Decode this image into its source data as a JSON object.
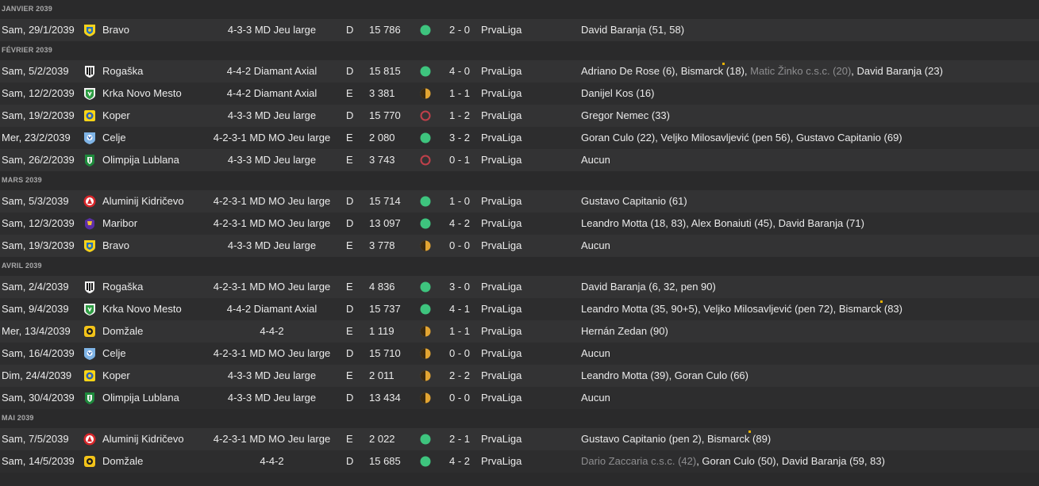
{
  "colors": {
    "win": "#3ec47e",
    "draw": "#e3a532",
    "loss": "#c0404a",
    "starMarker": "#e8b100"
  },
  "months": [
    {
      "label": "JANVIER 2039",
      "matches": [
        {
          "date": "Sam, 29/1/2039",
          "team": "Bravo",
          "badge": "bravo-badge-icon",
          "formation": "4-3-3 MD Jeu large",
          "venue": "D",
          "attendance": "15 786",
          "result": "win",
          "score": "2 - 0",
          "competition": "PrvaLiga",
          "scorers": [
            {
              "text": "David Baranja (51, 58)"
            }
          ]
        }
      ]
    },
    {
      "label": "FÉVRIER 2039",
      "matches": [
        {
          "date": "Sam, 5/2/2039",
          "team": "Rogaška",
          "badge": "rogaska-badge-icon",
          "formation": "4-4-2 Diamant Axial",
          "venue": "D",
          "attendance": "15 815",
          "result": "win",
          "score": "4 - 0",
          "competition": "PrvaLiga",
          "scorers": [
            {
              "text": "Adriano De Rose (6), "
            },
            {
              "text": "Bismarck",
              "star": true
            },
            {
              "text": " (18), "
            },
            {
              "text": "Matic Žinko c.s.c. (20)",
              "muted": true
            },
            {
              "text": ", David Baranja (23)"
            }
          ]
        },
        {
          "date": "Sam, 12/2/2039",
          "team": "Krka Novo Mesto",
          "badge": "krka-badge-icon",
          "formation": "4-4-2 Diamant Axial",
          "venue": "E",
          "attendance": "3 381",
          "result": "draw",
          "score": "1 - 1",
          "competition": "PrvaLiga",
          "scorers": [
            {
              "text": "Danijel Kos (16)"
            }
          ]
        },
        {
          "date": "Sam, 19/2/2039",
          "team": "Koper",
          "badge": "koper-badge-icon",
          "formation": "4-3-3 MD Jeu large",
          "venue": "D",
          "attendance": "15 770",
          "result": "loss",
          "score": "1 - 2",
          "competition": "PrvaLiga",
          "scorers": [
            {
              "text": "Gregor Nemec (33)"
            }
          ]
        },
        {
          "date": "Mer, 23/2/2039",
          "team": "Celje",
          "badge": "celje-badge-icon",
          "formation": "4-2-3-1 MD MO Jeu large",
          "venue": "E",
          "attendance": "2 080",
          "result": "win",
          "score": "3 - 2",
          "competition": "PrvaLiga",
          "scorers": [
            {
              "text": "Goran Culo (22), Veljko Milosavljević (pen 56), Gustavo Capitanio (69)"
            }
          ]
        },
        {
          "date": "Sam, 26/2/2039",
          "team": "Olimpija Lublana",
          "badge": "olimpija-badge-icon",
          "formation": "4-3-3 MD Jeu large",
          "venue": "E",
          "attendance": "3 743",
          "result": "loss",
          "score": "0 - 1",
          "competition": "PrvaLiga",
          "scorers": [
            {
              "text": "Aucun"
            }
          ]
        }
      ]
    },
    {
      "label": "MARS 2039",
      "matches": [
        {
          "date": "Sam, 5/3/2039",
          "team": "Aluminij Kidričevo",
          "badge": "aluminij-badge-icon",
          "formation": "4-2-3-1 MD MO Jeu large",
          "venue": "D",
          "attendance": "15 714",
          "result": "win",
          "score": "1 - 0",
          "competition": "PrvaLiga",
          "scorers": [
            {
              "text": "Gustavo Capitanio (61)"
            }
          ]
        },
        {
          "date": "Sam, 12/3/2039",
          "team": "Maribor",
          "badge": "maribor-badge-icon",
          "formation": "4-2-3-1 MD MO Jeu large",
          "venue": "D",
          "attendance": "13 097",
          "result": "win",
          "score": "4 - 2",
          "competition": "PrvaLiga",
          "scorers": [
            {
              "text": "Leandro Motta (18, 83), Alex Bonaiuti (45), David Baranja (71)"
            }
          ]
        },
        {
          "date": "Sam, 19/3/2039",
          "team": "Bravo",
          "badge": "bravo-badge-icon",
          "formation": "4-3-3 MD Jeu large",
          "venue": "E",
          "attendance": "3 778",
          "result": "draw",
          "score": "0 - 0",
          "competition": "PrvaLiga",
          "scorers": [
            {
              "text": "Aucun"
            }
          ]
        }
      ]
    },
    {
      "label": "AVRIL 2039",
      "matches": [
        {
          "date": "Sam, 2/4/2039",
          "team": "Rogaška",
          "badge": "rogaska-badge-icon",
          "formation": "4-2-3-1 MD MO Jeu large",
          "venue": "E",
          "attendance": "4 836",
          "result": "win",
          "score": "3 - 0",
          "competition": "PrvaLiga",
          "scorers": [
            {
              "text": "David Baranja (6, 32, pen 90)"
            }
          ]
        },
        {
          "date": "Sam, 9/4/2039",
          "team": "Krka Novo Mesto",
          "badge": "krka-badge-icon",
          "formation": "4-4-2 Diamant Axial",
          "venue": "D",
          "attendance": "15 737",
          "result": "win",
          "score": "4 - 1",
          "competition": "PrvaLiga",
          "scorers": [
            {
              "text": "Leandro Motta (35, 90+5), Veljko Milosavljević (pen 72), "
            },
            {
              "text": "Bismarck",
              "star": true
            },
            {
              "text": " (83)"
            }
          ]
        },
        {
          "date": "Mer, 13/4/2039",
          "team": "Domžale",
          "badge": "domzale-badge-icon",
          "formation": "4-4-2",
          "venue": "E",
          "attendance": "1 119",
          "result": "draw",
          "score": "1 - 1",
          "competition": "PrvaLiga",
          "scorers": [
            {
              "text": "Hernán Zedan (90)"
            }
          ]
        },
        {
          "date": "Sam, 16/4/2039",
          "team": "Celje",
          "badge": "celje-badge-icon",
          "formation": "4-2-3-1 MD MO Jeu large",
          "venue": "D",
          "attendance": "15 710",
          "result": "draw",
          "score": "0 - 0",
          "competition": "PrvaLiga",
          "scorers": [
            {
              "text": "Aucun"
            }
          ]
        },
        {
          "date": "Dim, 24/4/2039",
          "team": "Koper",
          "badge": "koper-badge-icon",
          "formation": "4-3-3 MD Jeu large",
          "venue": "E",
          "attendance": "2 011",
          "result": "draw",
          "score": "2 - 2",
          "competition": "PrvaLiga",
          "scorers": [
            {
              "text": "Leandro Motta (39), Goran Culo (66)"
            }
          ]
        },
        {
          "date": "Sam, 30/4/2039",
          "team": "Olimpija Lublana",
          "badge": "olimpija-badge-icon",
          "formation": "4-3-3 MD Jeu large",
          "venue": "D",
          "attendance": "13 434",
          "result": "draw",
          "score": "0 - 0",
          "competition": "PrvaLiga",
          "scorers": [
            {
              "text": "Aucun"
            }
          ]
        }
      ]
    },
    {
      "label": "MAI 2039",
      "matches": [
        {
          "date": "Sam, 7/5/2039",
          "team": "Aluminij Kidričevo",
          "badge": "aluminij-badge-icon",
          "formation": "4-2-3-1 MD MO Jeu large",
          "venue": "E",
          "attendance": "2 022",
          "result": "win",
          "score": "2 - 1",
          "competition": "PrvaLiga",
          "scorers": [
            {
              "text": "Gustavo Capitanio (pen 2), "
            },
            {
              "text": "Bismarck",
              "star": true
            },
            {
              "text": " (89)"
            }
          ]
        },
        {
          "date": "Sam, 14/5/2039",
          "team": "Domžale",
          "badge": "domzale-badge-icon",
          "formation": "4-4-2",
          "venue": "D",
          "attendance": "15 685",
          "result": "win",
          "score": "4 - 2",
          "competition": "PrvaLiga",
          "scorers": [
            {
              "text": "Dario Zaccaria c.s.c. (42)",
              "muted": true
            },
            {
              "text": ", Goran Culo (50), David Baranja (59, 83)"
            }
          ]
        }
      ]
    }
  ]
}
